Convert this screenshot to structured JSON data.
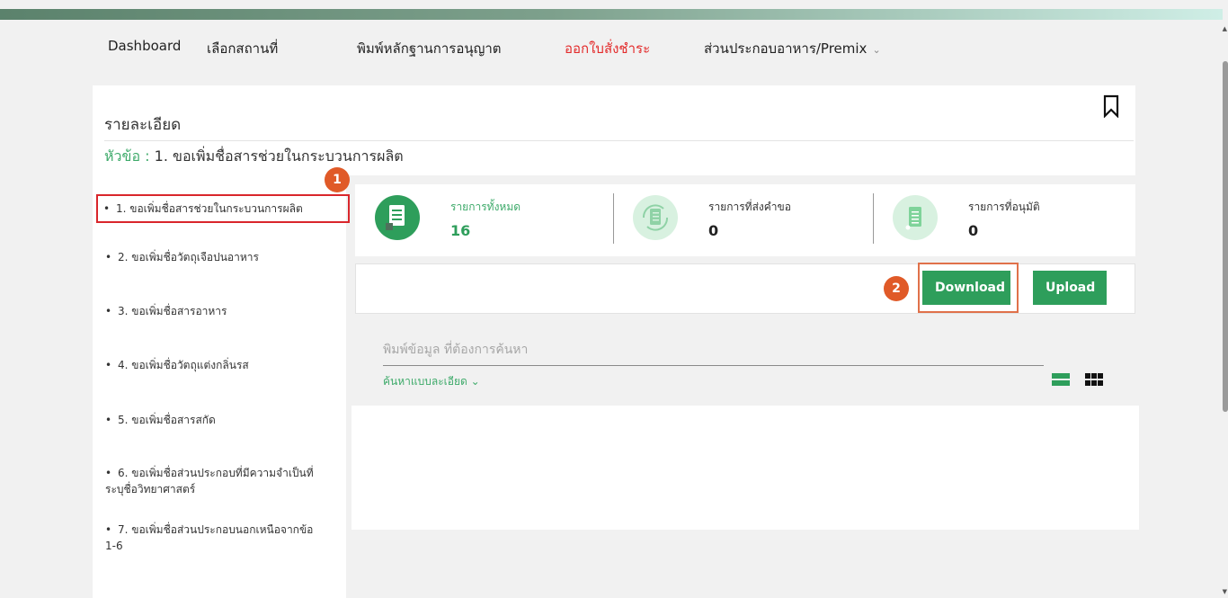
{
  "nav": {
    "items": [
      {
        "label": "Dashboard"
      },
      {
        "label": "เลือกสถานที่"
      },
      {
        "label": "พิมพ์หลักฐานการอนุญาต"
      },
      {
        "label": "ออกใบสั่งชำระ"
      },
      {
        "label": "ส่วนประกอบอาหาร/Premix"
      }
    ],
    "active_index": 3,
    "dropdown_glyph": "⌄"
  },
  "details": {
    "title": "รายละเอียด",
    "subject_label": "หัวข้อ :",
    "subject_value": " 1. ขอเพิ่มชื่อสารช่วยในกระบวนการผลิต"
  },
  "sidebar": {
    "items": [
      {
        "label": "1. ขอเพิ่มชื่อสารช่วยในกระบวนการผลิต"
      },
      {
        "label": "2. ขอเพิ่มชื่อวัตถุเจือปนอาหาร"
      },
      {
        "label": "3. ขอเพิ่มชื่อสารอาหาร"
      },
      {
        "label": "4. ขอเพิ่มชื่อวัตถุแต่งกลิ่นรส"
      },
      {
        "label": "5. ขอเพิ่มชื่อสารสกัด"
      },
      {
        "label": "6. ขอเพิ่มชื่อส่วนประกอบที่มีความจำเป็นที่ระบุชื่อวิทยาศาสตร์"
      },
      {
        "label": "7. ขอเพิ่มชื่อส่วนประกอบนอกเหนือจากข้อ 1-6"
      }
    ],
    "selected_index": 0,
    "bullet": "•"
  },
  "steps": {
    "one": "1",
    "two": "2"
  },
  "stats": [
    {
      "label": "รายการทั้งหมด",
      "value": "16",
      "icon": "document-icon"
    },
    {
      "label": "รายการที่ส่งคำขอ",
      "value": "0",
      "icon": "refresh-document-icon"
    },
    {
      "label": "รายการที่อนุมัติ",
      "value": "0",
      "icon": "approved-document-icon"
    }
  ],
  "toolbar": {
    "download_label": "Download",
    "upload_label": "Upload"
  },
  "search": {
    "placeholder": "พิมพ์ข้อมูล ที่ต้องการค้นหา",
    "advanced_label": "ค้นหาแบบละเอียด ⌄"
  },
  "colors": {
    "accent_green": "#2e9e5b",
    "active_nav_red": "#e32b2b",
    "highlight_red": "#d9262b",
    "step_badge_orange": "#e05a28"
  }
}
